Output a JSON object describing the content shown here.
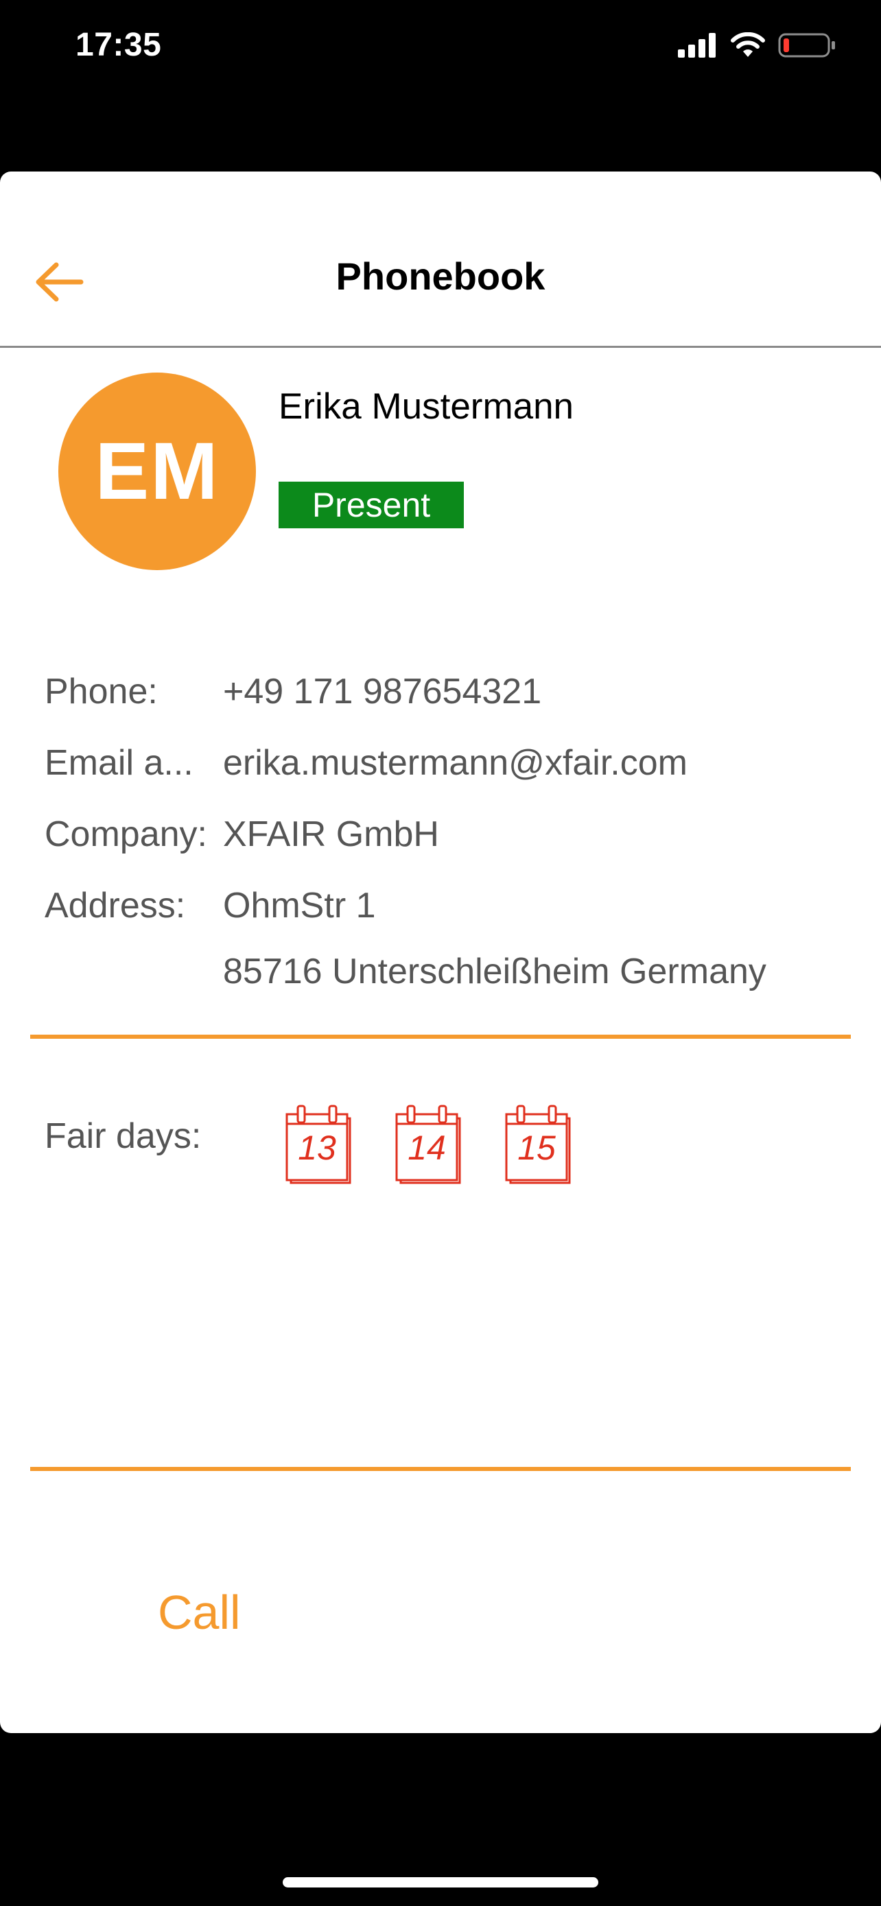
{
  "status_bar": {
    "time": "17:35"
  },
  "nav": {
    "title": "Phonebook",
    "back_icon": "arrow-left-icon"
  },
  "contact": {
    "initials": "EM",
    "name": "Erika Mustermann",
    "status": "Present",
    "status_color": "#0c8a1b"
  },
  "details": {
    "phone_label": "Phone:",
    "phone_value": "+49 171 987654321",
    "email_label": "Email a...",
    "email_value": "erika.mustermann@xfair.com",
    "company_label": "Company:",
    "company_value": "XFAIR GmbH",
    "address_label": "Address:",
    "address_line1": "OhmStr 1",
    "address_line2": "85716 Unterschleißheim Germany"
  },
  "fair": {
    "label": "Fair days:",
    "days": [
      "13",
      "14",
      "15"
    ]
  },
  "actions": {
    "call_label": "Call"
  },
  "colors": {
    "accent": "#f59a2e",
    "calendar": "#e0301e"
  }
}
